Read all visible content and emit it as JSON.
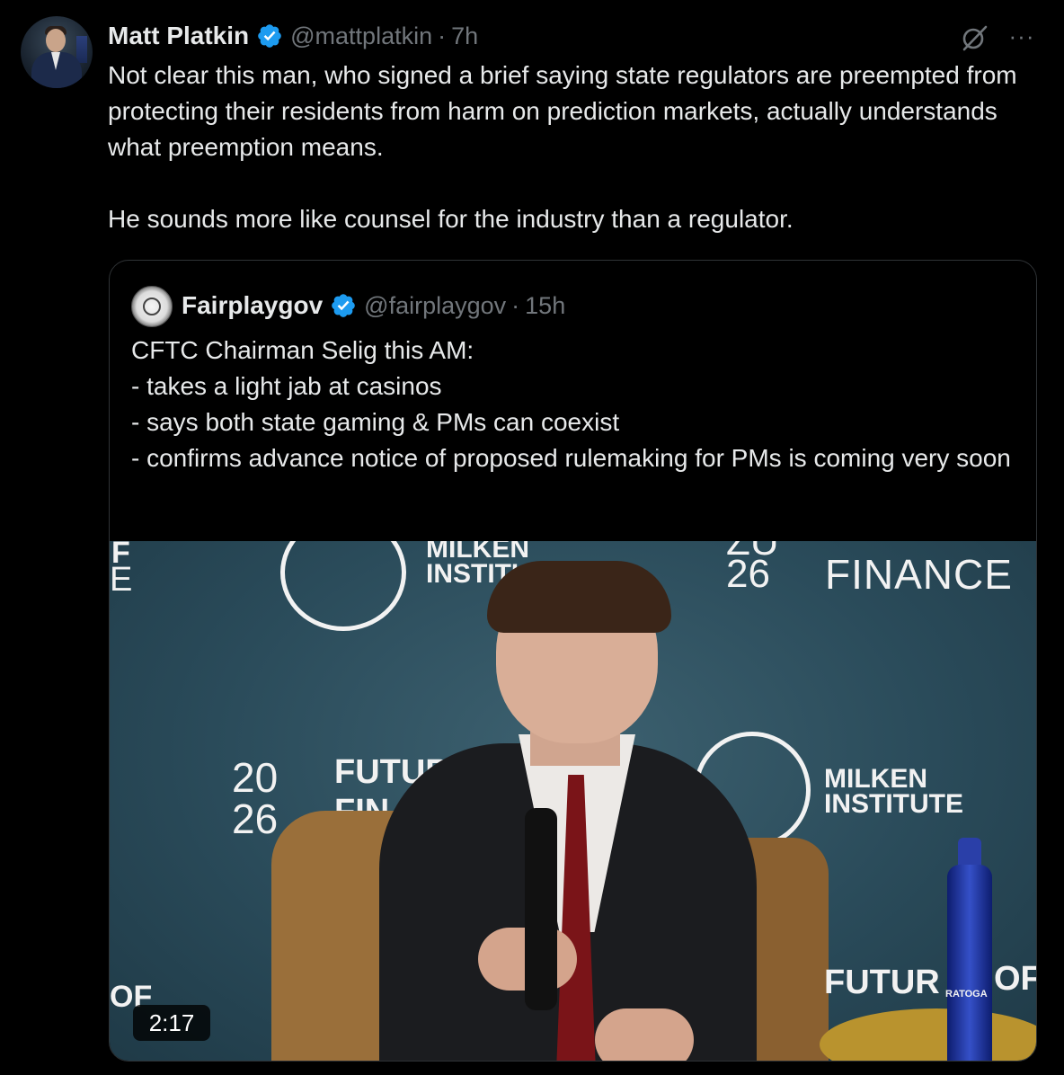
{
  "tweet": {
    "author_name": "Matt Platkin",
    "handle": "@mattplatkin",
    "separator": "·",
    "time": "7h",
    "more_label": "···",
    "paragraphs": [
      "Not clear this man, who signed a brief saying state regulators are preempted from protecting their residents from harm on prediction markets, actually understands what preemption means.",
      "He sounds more like counsel for the industry than a regulator."
    ]
  },
  "quoted": {
    "author_name": "Fairplaygov",
    "handle": "@fairplaygov",
    "separator": "·",
    "time": "15h",
    "lines": [
      "CFTC Chairman Selig this AM:",
      "- takes a light jab at casinos",
      "- says both state gaming & PMs can coexist",
      "- confirms advance notice of proposed rulemaking for PMs is coming very soon"
    ],
    "video": {
      "duration": "2:17",
      "backdrop": {
        "left_edge_1": "F",
        "left_edge_2": "E",
        "milken_top_1": "MILKEN",
        "milken_top_2": "INSTITU",
        "year_top": "26",
        "year_top_cut": "ZU",
        "finance_top": "FINANCE",
        "year_mid_1": "20",
        "year_mid_2": "26",
        "future_mid": "FUTURE",
        "future_mid_2": "FIN",
        "milken_mid_1": "MILKEN",
        "milken_mid_2": "INSTITUTE",
        "future_bottom": "FUTUR",
        "future_bottom_2": "OF",
        "bottom_left": "OF",
        "bottle_label": "RATOGA"
      }
    }
  },
  "colors": {
    "background": "#000000",
    "text": "#e7e9ea",
    "muted": "#71767b",
    "verified": "#1d9bf0",
    "border": "#2f3336"
  }
}
